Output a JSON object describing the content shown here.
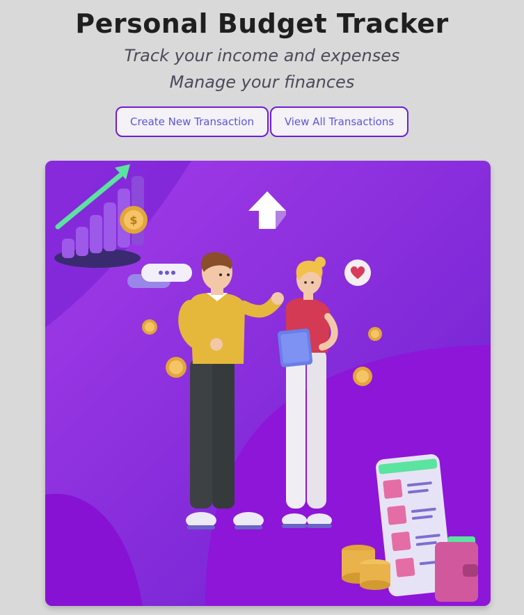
{
  "header": {
    "title": "Personal Budget Tracker",
    "subtitle_1": "Track your income and expenses",
    "subtitle_2": "Manage your finances"
  },
  "actions": {
    "create_label": "Create New Transaction",
    "view_label": "View All Transactions"
  },
  "hero": {
    "alt": "Two people discussing finances with charts, coins and a phone"
  },
  "colors": {
    "accent": "#6d1dd6",
    "button_text": "#5b56d8",
    "hero_bg": "#8b1fdc",
    "page_bg": "#d9d9d9"
  }
}
